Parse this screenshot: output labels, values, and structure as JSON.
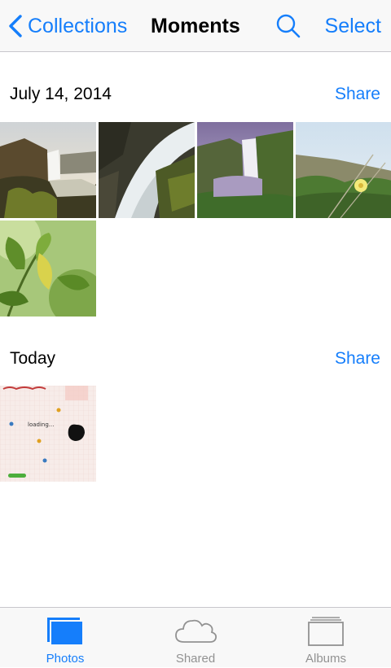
{
  "nav": {
    "back_label": "Collections",
    "title": "Moments",
    "select_label": "Select",
    "search_icon": "search-icon"
  },
  "sections": [
    {
      "date": "July 14, 2014",
      "share_label": "Share",
      "photos": [
        "waterfall-sunset",
        "waterfall-longexposure",
        "waterfall-cliff",
        "wildflowers",
        "green-leaf"
      ]
    },
    {
      "date": "Today",
      "share_label": "Share",
      "photos": [
        "game-screenshot"
      ]
    }
  ],
  "game_thumb": {
    "loading_text": "loading..."
  },
  "tabs": [
    {
      "label": "Photos",
      "icon": "photos-icon",
      "active": true
    },
    {
      "label": "Shared",
      "icon": "cloud-icon",
      "active": false
    },
    {
      "label": "Albums",
      "icon": "albums-icon",
      "active": false
    }
  ],
  "colors": {
    "accent": "#157efb",
    "inactive": "#929292",
    "bar_bg": "#f8f8f8"
  }
}
